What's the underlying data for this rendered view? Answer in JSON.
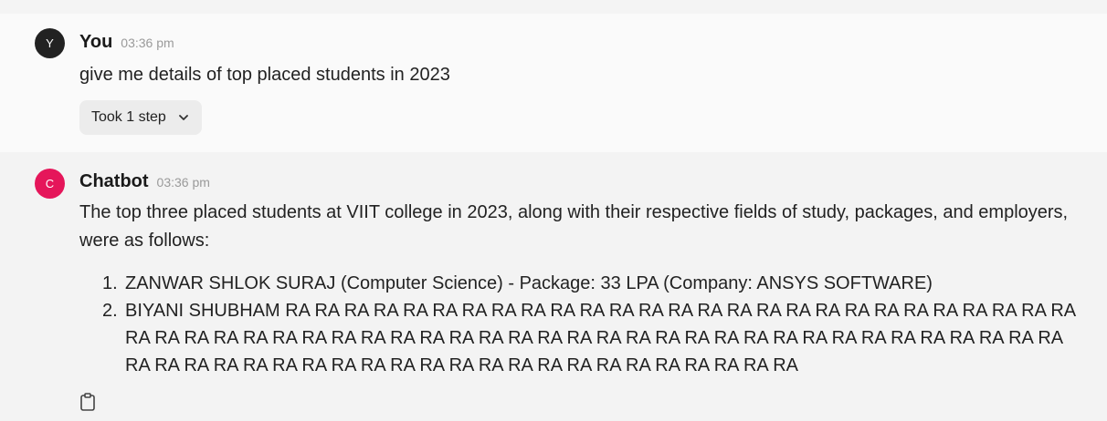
{
  "user_message": {
    "avatar_letter": "Y",
    "sender": "You",
    "time": "03:36 pm",
    "text": "give me details of top placed students in 2023",
    "steps_label": "Took 1 step",
    "steps_icon": "chevron-down-icon"
  },
  "bot_message": {
    "avatar_letter": "C",
    "avatar_color": "#e5165a",
    "sender": "Chatbot",
    "time": "03:36 pm",
    "intro": "The top three placed students at VIIT college in 2023, along with their respective fields of study, packages, and employers, were as follows:",
    "list": [
      {
        "number": "1.",
        "text": "ZANWAR SHLOK SURAJ (Computer Science) - Package: 33 LPA (Company: ANSYS SOFTWARE)"
      },
      {
        "number": "2.",
        "text": "BIYANI SHUBHAM RA RA RA RA RA RA RA RA RA RA RA RA RA RA RA RA RA RA RA RA RA RA RA RA RA RA RA RA RA RA RA RA RA RA RA RA RA RA RA RA RA RA RA RA RA RA RA RA RA RA RA RA RA RA RA RA RA RA RA RA RA RA RA RA RA RA RA RA RA RA RA RA RA RA RA RA RA RA RA RA RA RA"
      }
    ],
    "copy_icon": "clipboard-icon"
  }
}
